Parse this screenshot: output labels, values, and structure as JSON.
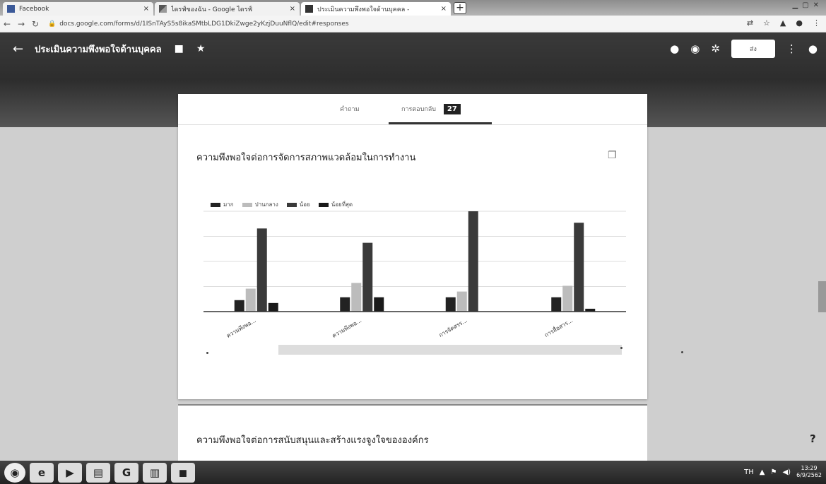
{
  "browser": {
    "tabs": [
      {
        "label": "Facebook",
        "icon": "facebook-icon"
      },
      {
        "label": "ไดรฟ์ของฉัน - Google ไดรฟ์",
        "icon": "drive-icon"
      },
      {
        "label": "ประเมินความพึงพอใจด้านบุคคล -",
        "icon": "forms-icon"
      }
    ],
    "url": "docs.google.com/forms/d/1ISnTAyS5s8ikaSMtbLDG1DkiZwge2yKzjDuuNflQ/edit#responses"
  },
  "form": {
    "title": "ประเมินความพึงพอใจด้านบุคคล",
    "send_label": "ส่ง",
    "tab_questions": "คำถาม",
    "tab_responses": "การตอบกลับ",
    "response_count": "27"
  },
  "question1": {
    "title": "ความพึงพอใจต่อการจัดการสภาพแวดล้อมในการทำงาน"
  },
  "question2": {
    "title": "ความพึงพอใจต่อการสนับสนุนและสร้างแรงจูงใจขององค์กร"
  },
  "colors": {
    "dark": "#222222",
    "light": "#bcbcbc",
    "medium": "#3a3a3a",
    "darkest": "#1a1a1a"
  },
  "chart_data": {
    "type": "bar",
    "categories": [
      "ความพึงพอ...",
      "ความพึงพอ...",
      "การจัดสรร...",
      "การสื่อสาร..."
    ],
    "series": [
      {
        "name": "มาก",
        "values": [
          4,
          5,
          5,
          5
        ]
      },
      {
        "name": "ปานกลาง",
        "values": [
          8,
          10,
          7,
          9
        ]
      },
      {
        "name": "น้อย",
        "values": [
          29,
          24,
          35,
          31
        ]
      },
      {
        "name": "น้อยที่สุด",
        "values": [
          3,
          5,
          0,
          1
        ]
      }
    ],
    "ylim": [
      0,
      35
    ],
    "grid": true,
    "legend": "top-left"
  },
  "taskbar": {
    "clock_time": "13:29",
    "clock_date": "6/9/2562"
  }
}
